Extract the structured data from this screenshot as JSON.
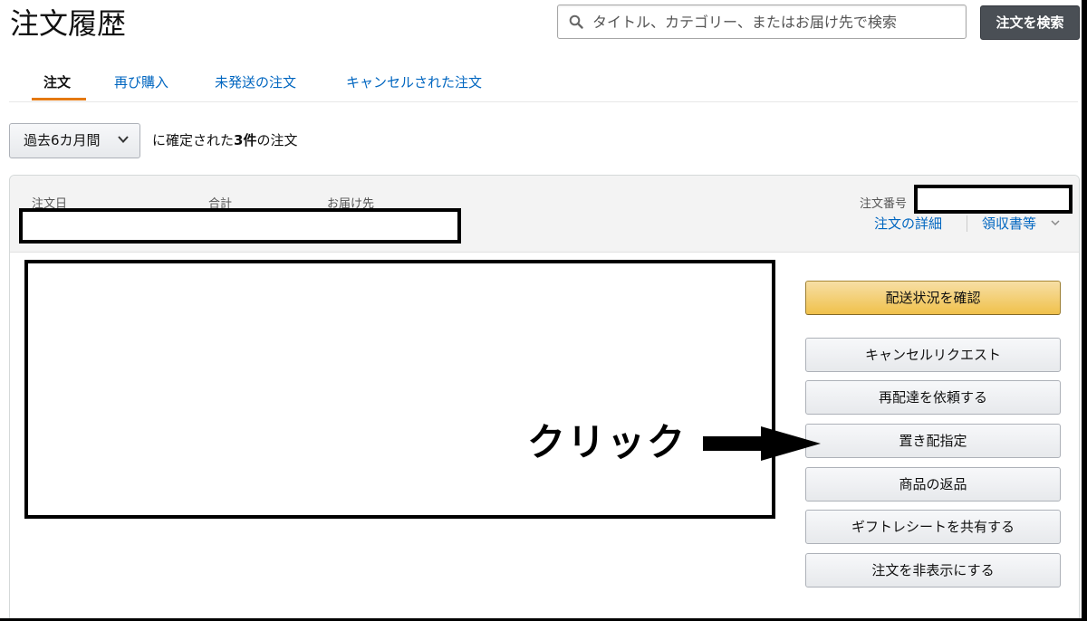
{
  "page": {
    "title": "注文履歴"
  },
  "search": {
    "placeholder": "タイトル、カテゴリー、またはお届け先で検索",
    "button_label": "注文を検索"
  },
  "tabs": [
    {
      "label": "注文",
      "active": true
    },
    {
      "label": "再び購入",
      "active": false
    },
    {
      "label": "未発送の注文",
      "active": false
    },
    {
      "label": "キャンセルされた注文",
      "active": false
    }
  ],
  "filter": {
    "range_value": "過去6カ月間",
    "summary_prefix": "に確定された",
    "summary_count": "3件",
    "summary_suffix": "の注文"
  },
  "order": {
    "labels": {
      "order_date": "注文日",
      "total": "合計",
      "ship_to": "お届け先",
      "order_number": "注文番号"
    },
    "links": {
      "details": "注文の詳細",
      "receipt": "領収書等"
    },
    "actions": [
      {
        "label": "配送状況を確認",
        "primary": true
      },
      {
        "label": "キャンセルリクエスト",
        "primary": false
      },
      {
        "label": "再配達を依頼する",
        "primary": false
      },
      {
        "label": "置き配指定",
        "primary": false
      },
      {
        "label": "商品の返品",
        "primary": false
      },
      {
        "label": "ギフトレシートを共有する",
        "primary": false
      },
      {
        "label": "注文を非表示にする",
        "primary": false
      }
    ]
  },
  "annotation": {
    "callout": "クリック"
  },
  "colors": {
    "link": "#0066c0",
    "primary_button": "#f0c14b",
    "tab_underline": "#e47911",
    "search_button": "#4a4f55"
  },
  "icons": {
    "search": "search-icon",
    "chevron": "chevron-down-icon",
    "arrow": "arrow-right-icon"
  }
}
